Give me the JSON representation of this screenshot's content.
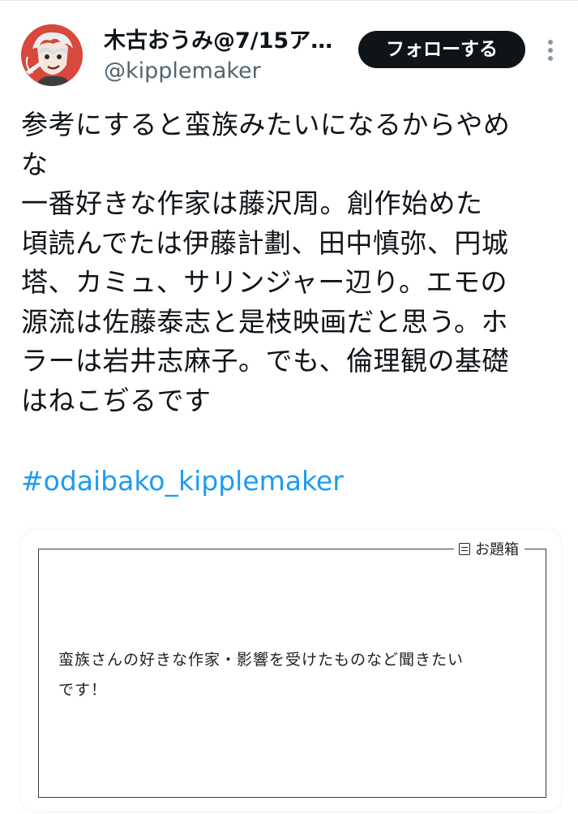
{
  "user": {
    "display_name": "木古おうみ@7/15ア…",
    "handle": "@kipplemaker",
    "avatar_icon": "avatar-illustration"
  },
  "follow_button": {
    "label": "フォローする"
  },
  "more_icon": "more-vertical-icon",
  "tweet": {
    "lines": [
      "参考にすると蛮族みたいになるからやめ",
      "な",
      "一番好きな作家は藤沢周。創作始めた",
      "頃読んでたは伊藤計劃、田中慎弥、円城",
      "塔、カミュ、サリンジャー辺り。エモの",
      "源流は佐藤泰志と是枝映画だと思う。ホ",
      "ラーは岩井志麻子。でも、倫理観の基礎",
      "はねこぢるです"
    ],
    "hashtag": "#odaibako_kipplemaker"
  },
  "odai_card": {
    "label": "お題箱",
    "question_lines": [
      "蛮族さんの好きな作家・影響を受けたものなど聞きたい",
      "です！"
    ]
  },
  "colors": {
    "text": "#0f1419",
    "secondary": "#536471",
    "link": "#1d9bf0",
    "button_bg": "#0f1419"
  }
}
